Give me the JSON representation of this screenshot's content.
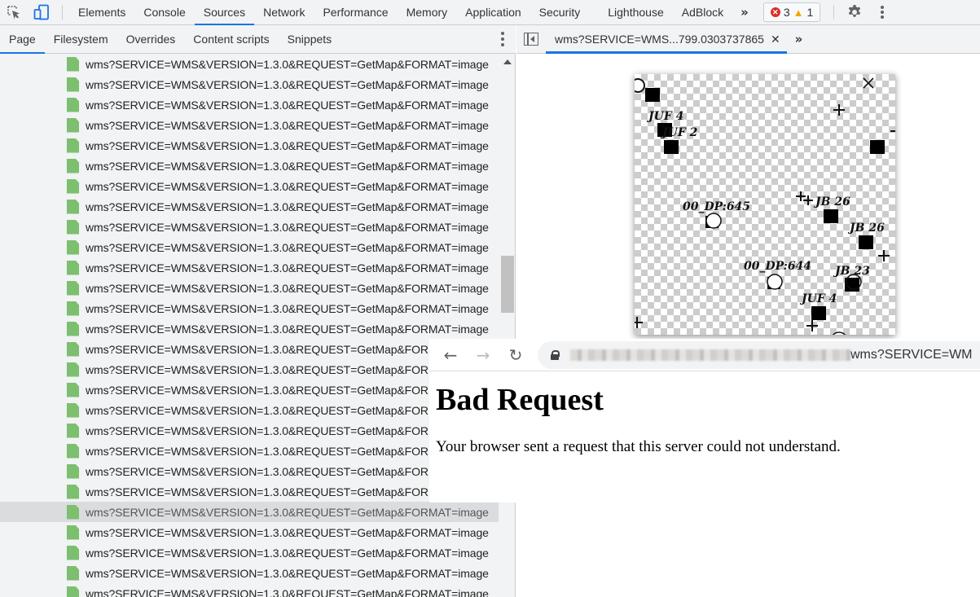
{
  "devtools": {
    "main_tabs": [
      {
        "label": "Elements"
      },
      {
        "label": "Console"
      },
      {
        "label": "Sources",
        "active": true
      },
      {
        "label": "Network"
      },
      {
        "label": "Performance"
      },
      {
        "label": "Memory"
      },
      {
        "label": "Application"
      },
      {
        "label": "Security"
      },
      {
        "label": "Lighthouse"
      },
      {
        "label": "AdBlock"
      }
    ],
    "more_tabs_icon": "»",
    "issues": {
      "errors": "3",
      "warnings": "1"
    },
    "icons": {
      "inspect": "inspect-element-icon",
      "device": "device-toolbar-icon",
      "settings": "gear-icon",
      "menu": "kebab-menu-icon"
    }
  },
  "sources": {
    "subtabs": [
      {
        "label": "Page",
        "active": true
      },
      {
        "label": "Filesystem"
      },
      {
        "label": "Overrides"
      },
      {
        "label": "Content scripts"
      },
      {
        "label": "Snippets"
      }
    ],
    "file_name": "wms?SERVICE=WMS&VERSION=1.3.0&REQUEST=GetMap&FORMAT=image",
    "files_visible_count": 27,
    "selected_index": 22
  },
  "editor": {
    "open_tab": "wms?SERVICE=WMS...799.0303737865",
    "close_glyph": "✕",
    "more_glyph": "»"
  },
  "map_preview": {
    "labels": [
      {
        "text": "JUF 4"
      },
      {
        "text": "JUF 2"
      },
      {
        "text": "00_DP:645"
      },
      {
        "text": "JB 26"
      },
      {
        "text": "JB 26"
      },
      {
        "text": "00_DP:644"
      },
      {
        "text": "JB 23"
      },
      {
        "text": "JUF 4"
      }
    ]
  },
  "browser": {
    "url_visible": "wms?SERVICE=WM",
    "url_host": "[blurred]",
    "back": "←",
    "forward": "→",
    "reload": "↻",
    "page_title": "Bad Request",
    "page_message": "Your browser sent a request that this server could not understand."
  }
}
